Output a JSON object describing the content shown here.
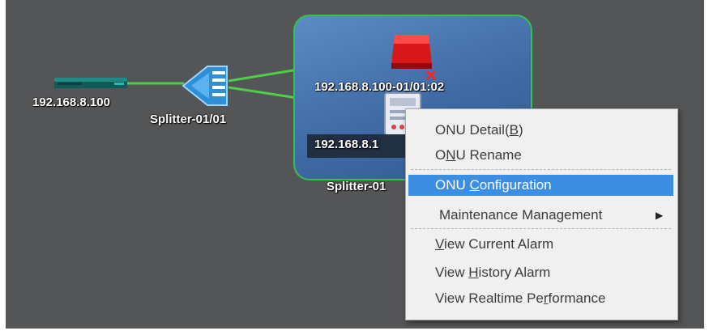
{
  "topology": {
    "nodes": {
      "olt_label": "192.168.8.100",
      "splitter_label": "Splitter-01/01",
      "onu_red_label": "192.168.8.100-01/01:02",
      "onu_white_label": "192.168.8.1",
      "group_label": "Splitter-01"
    },
    "colors": {
      "canvas": "#545557",
      "link": "#4fcf49",
      "group_border": "#36c24a",
      "alarm": "#d81818",
      "menu_highlight": "#3c8ee2"
    }
  },
  "context_menu": {
    "items": [
      {
        "pre": "ONU Detail(",
        "accel": "B",
        "post": ")",
        "selected": false
      },
      {
        "pre": "O",
        "accel": "N",
        "post": "U Rename",
        "selected": false
      },
      {
        "pre": "ONU ",
        "accel": "C",
        "post": "onfiguration",
        "selected": true
      },
      {
        "pre": "Maintenance Management",
        "accel": "",
        "post": "",
        "selected": false,
        "submenu": true
      },
      {
        "pre": "",
        "accel": "V",
        "post": "iew Current Alarm",
        "selected": false
      },
      {
        "pre": "View ",
        "accel": "H",
        "post": "istory Alarm",
        "selected": false
      },
      {
        "pre": "View Realtime Pe",
        "accel": "r",
        "post": "formance",
        "selected": false
      }
    ]
  }
}
